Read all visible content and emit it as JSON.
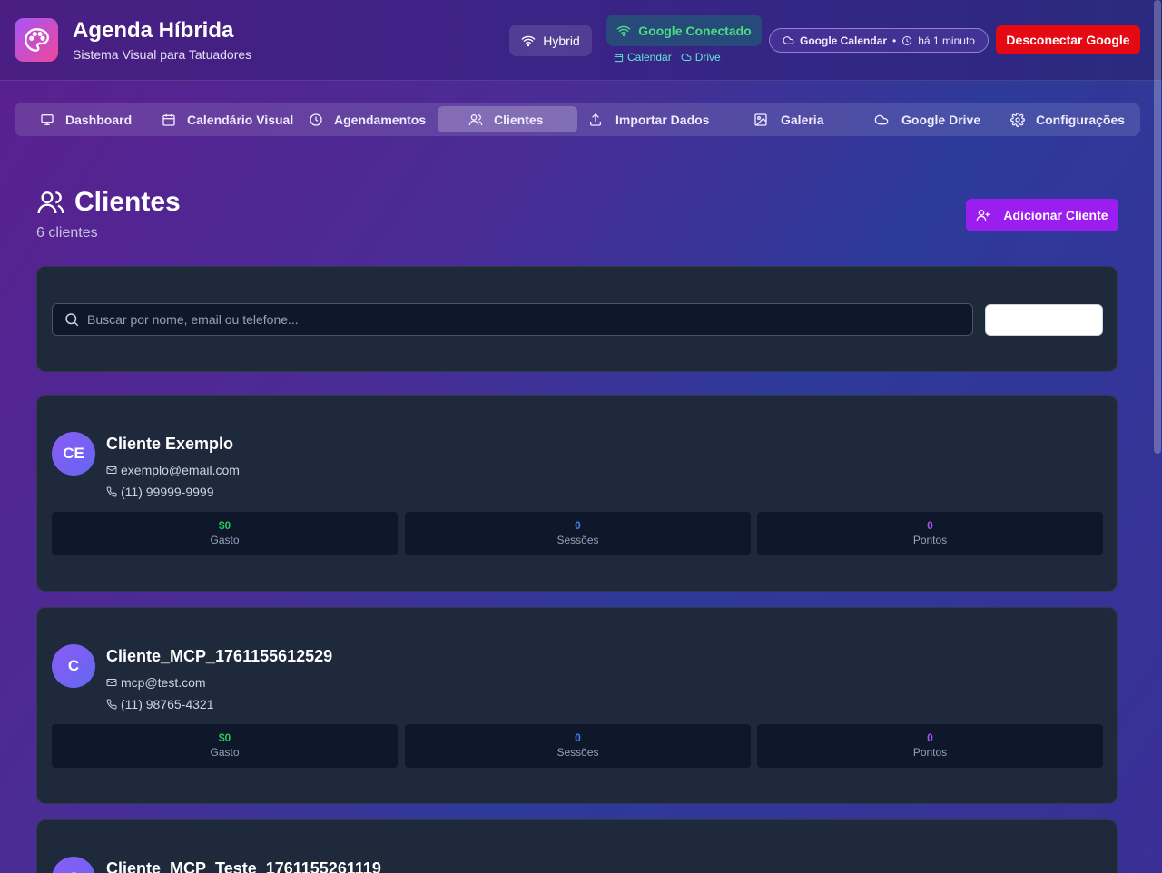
{
  "header": {
    "title": "Agenda Híbrida",
    "subtitle": "Sistema Visual para Tatuadores",
    "mode_label": "Hybrid",
    "google_status": "Google Conectado",
    "google_link_calendar": "Calendar",
    "google_link_drive": "Drive",
    "calendar_sync_label": "Google Calendar",
    "calendar_sync_time": "há 1 minuto",
    "disconnect_label": "Desconectar Google"
  },
  "nav": {
    "items": [
      {
        "label": "Dashboard",
        "icon": "monitor-icon"
      },
      {
        "label": "Calendário Visual",
        "icon": "calendar-icon"
      },
      {
        "label": "Agendamentos",
        "icon": "clock-icon"
      },
      {
        "label": "Clientes",
        "icon": "users-icon",
        "active": true
      },
      {
        "label": "Importar Dados",
        "icon": "upload-icon"
      },
      {
        "label": "Galeria",
        "icon": "image-icon"
      },
      {
        "label": "Google Drive",
        "icon": "cloud-icon"
      },
      {
        "label": "Configurações",
        "icon": "gear-icon"
      }
    ]
  },
  "page": {
    "title": "Clientes",
    "count": "6 clientes",
    "add_label": "Adicionar Cliente"
  },
  "search": {
    "placeholder": "Buscar por nome, email ou telefone...",
    "value": ""
  },
  "clients": [
    {
      "initials": "CE",
      "name": "Cliente Exemplo",
      "email": "exemplo@email.com",
      "phone": "(11) 99999-9999",
      "stats": [
        {
          "value": "$0",
          "label": "Gasto"
        },
        {
          "value": "0",
          "label": "Sessões"
        },
        {
          "value": "0",
          "label": "Pontos"
        }
      ]
    },
    {
      "initials": "C",
      "name": "Cliente_MCP_1761155612529",
      "email": "mcp@test.com",
      "phone": "(11) 98765-4321",
      "stats": [
        {
          "value": "$0",
          "label": "Gasto"
        },
        {
          "value": "0",
          "label": "Sessões"
        },
        {
          "value": "0",
          "label": "Pontos"
        }
      ]
    },
    {
      "initials": "C",
      "name": "Cliente_MCP_Teste_1761155261119"
    }
  ],
  "colors": {
    "stat_gasto": "#22c55e",
    "stat_sessoes": "#3b82f6",
    "stat_pontos": "#a855f7",
    "disconnect": "#e50914",
    "add_button": "#9b1df0"
  }
}
